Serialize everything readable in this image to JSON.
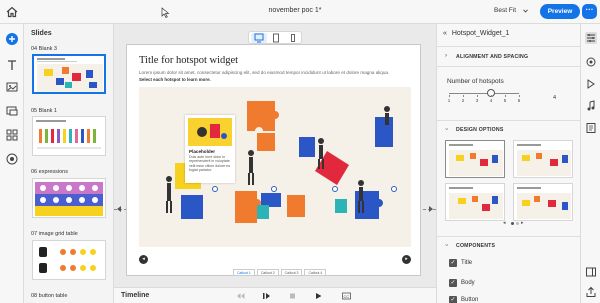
{
  "topbar": {
    "title": "november poc 1*",
    "zoom_label": "Best Fit",
    "preview_label": "Preview",
    "more_label": "···"
  },
  "slides_panel": {
    "title": "Slides",
    "items": [
      {
        "label": "04  Blank 3",
        "selected": true
      },
      {
        "label": "05  Blank 1",
        "selected": false
      },
      {
        "label": "06  expressions",
        "selected": false
      },
      {
        "label": "07  image grid table",
        "selected": false
      },
      {
        "label": "08  button table",
        "selected": false
      }
    ]
  },
  "slide": {
    "title": "Title for hotspot widget",
    "body": "Lorem ipsum dolor sit amet, consectetur adipiscing elit, sed do eiusmod tempor incididunt ut labore et dolore magna aliqua.",
    "instruction": "Select each hotspot to learn more.",
    "callout_title": "Placeholder",
    "callout_text": "Duis aute irure dolor in reprehenderit in voluptate velit esse cillum dolore eu fugiat pariatur.",
    "tabs": [
      "Callout 1",
      "Callout 2",
      "Callout 3",
      "Callout 4"
    ],
    "prev_label": "◂",
    "next_label": "▸"
  },
  "timeline": {
    "label": "Timeline"
  },
  "properties": {
    "header": "Hotspot_Widget_1",
    "sections": {
      "alignment": "ALIGNMENT AND SPACING",
      "design": "DESIGN OPTIONS",
      "components": "COMPONENTS"
    },
    "hotspots_label": "Number of hotspots",
    "hotspots_value": "4",
    "slider_ticks": [
      "1",
      "2",
      "3",
      "4",
      "5",
      "6"
    ],
    "slider_min": 1,
    "slider_max": 6,
    "slider_current": 4,
    "components": [
      {
        "label": "Title",
        "checked": true
      },
      {
        "label": "Body",
        "checked": true
      },
      {
        "label": "Button",
        "checked": true
      }
    ]
  },
  "colors": {
    "accent": "#1473e6",
    "puzzle_blue": "#2a57c5",
    "puzzle_orange": "#f07b2f",
    "puzzle_red": "#e2283d",
    "puzzle_yellow": "#f6d21e",
    "puzzle_teal": "#2bb3b5"
  }
}
